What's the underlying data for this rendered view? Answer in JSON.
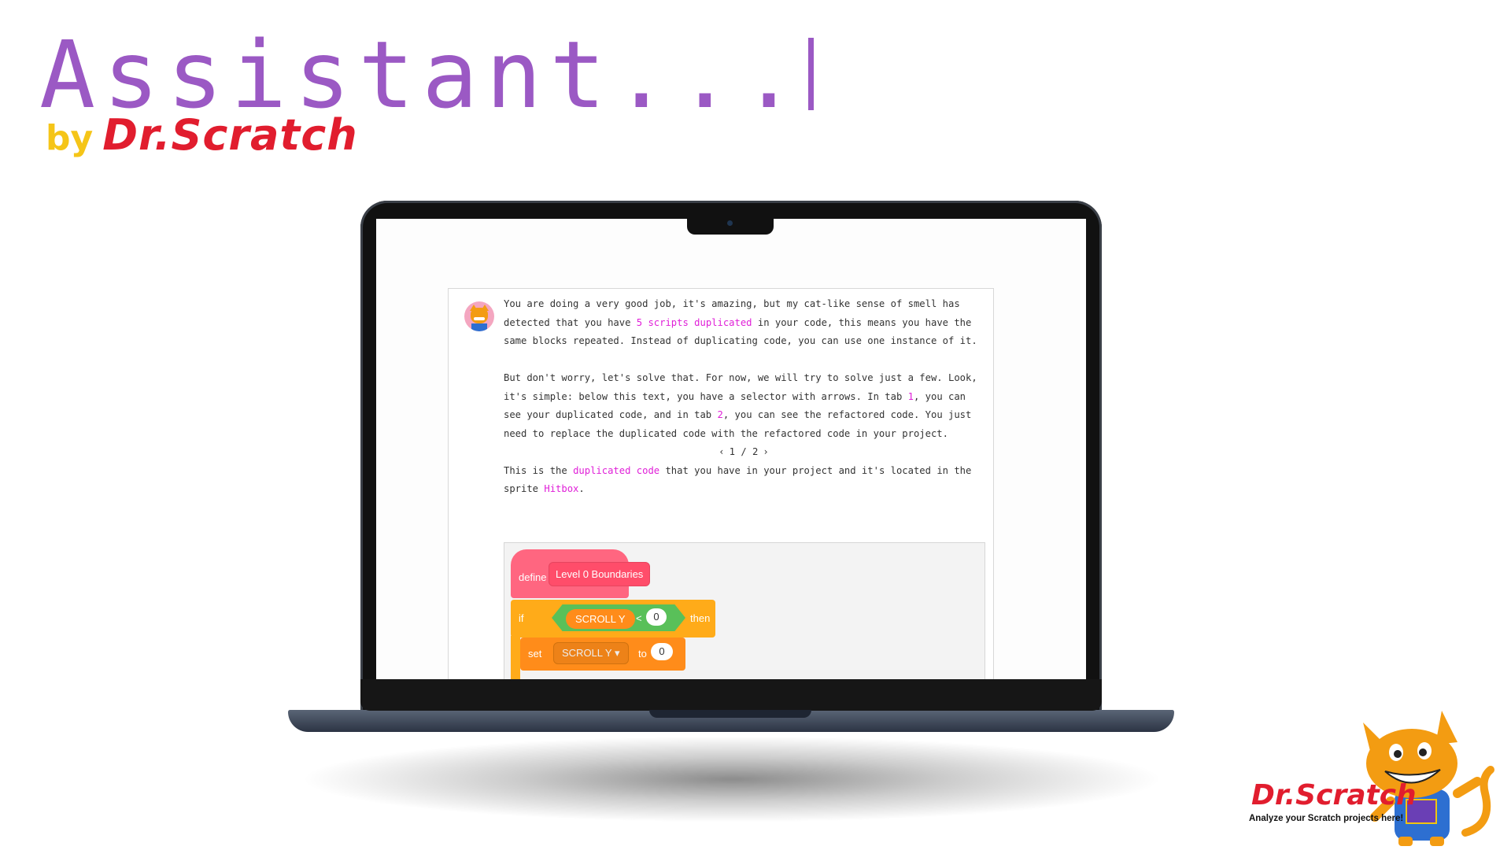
{
  "header": {
    "title": "Assistant...",
    "by": "by",
    "brand": "Dr.Scratch"
  },
  "chat": {
    "paragraph1": {
      "pre": "You are doing a very good job, it's amazing, but my cat-like sense of smell has detected that you have ",
      "highlight": "5 scripts duplicated",
      "post": " in your code, this means you have the same blocks repeated. Instead of duplicating code, you can use one instance of it."
    },
    "paragraph2": {
      "part1": "But don't worry, let's solve that. For now, we will try to solve just a few. Look, it's simple: below this text, you have a selector with arrows. In tab ",
      "tab1": "1",
      "part2": ", you can see your duplicated code, and in tab ",
      "tab2": "2",
      "part3": ", you can see the refactored code. You just need to replace the duplicated code with the refactored code in your project."
    },
    "pager": {
      "prev": "‹",
      "current": "1",
      "separator": "/",
      "total": "2",
      "next": "›"
    },
    "paragraph3": {
      "pre": "This is the ",
      "highlight": "duplicated code",
      "mid": " that you have in your project and it's located in the sprite ",
      "sprite": "Hitbox",
      "post": "."
    }
  },
  "blocks": {
    "define_label": "define",
    "define_name": "Level 0 Boundaries",
    "if_label": "if",
    "variable": "SCROLL Y",
    "operator": "<",
    "compare_value": "0",
    "then_label": "then",
    "set_label": "set",
    "set_variable": "SCROLL Y ▾",
    "to_label": "to",
    "set_value": "0"
  },
  "footer": {
    "brand": "Dr.Scratch",
    "tagline": "Analyze your Scratch projects here!"
  },
  "colors": {
    "title": "#9b59c4",
    "by": "#f5c518",
    "brand": "#e11d2e",
    "highlight": "#e01fd8"
  }
}
